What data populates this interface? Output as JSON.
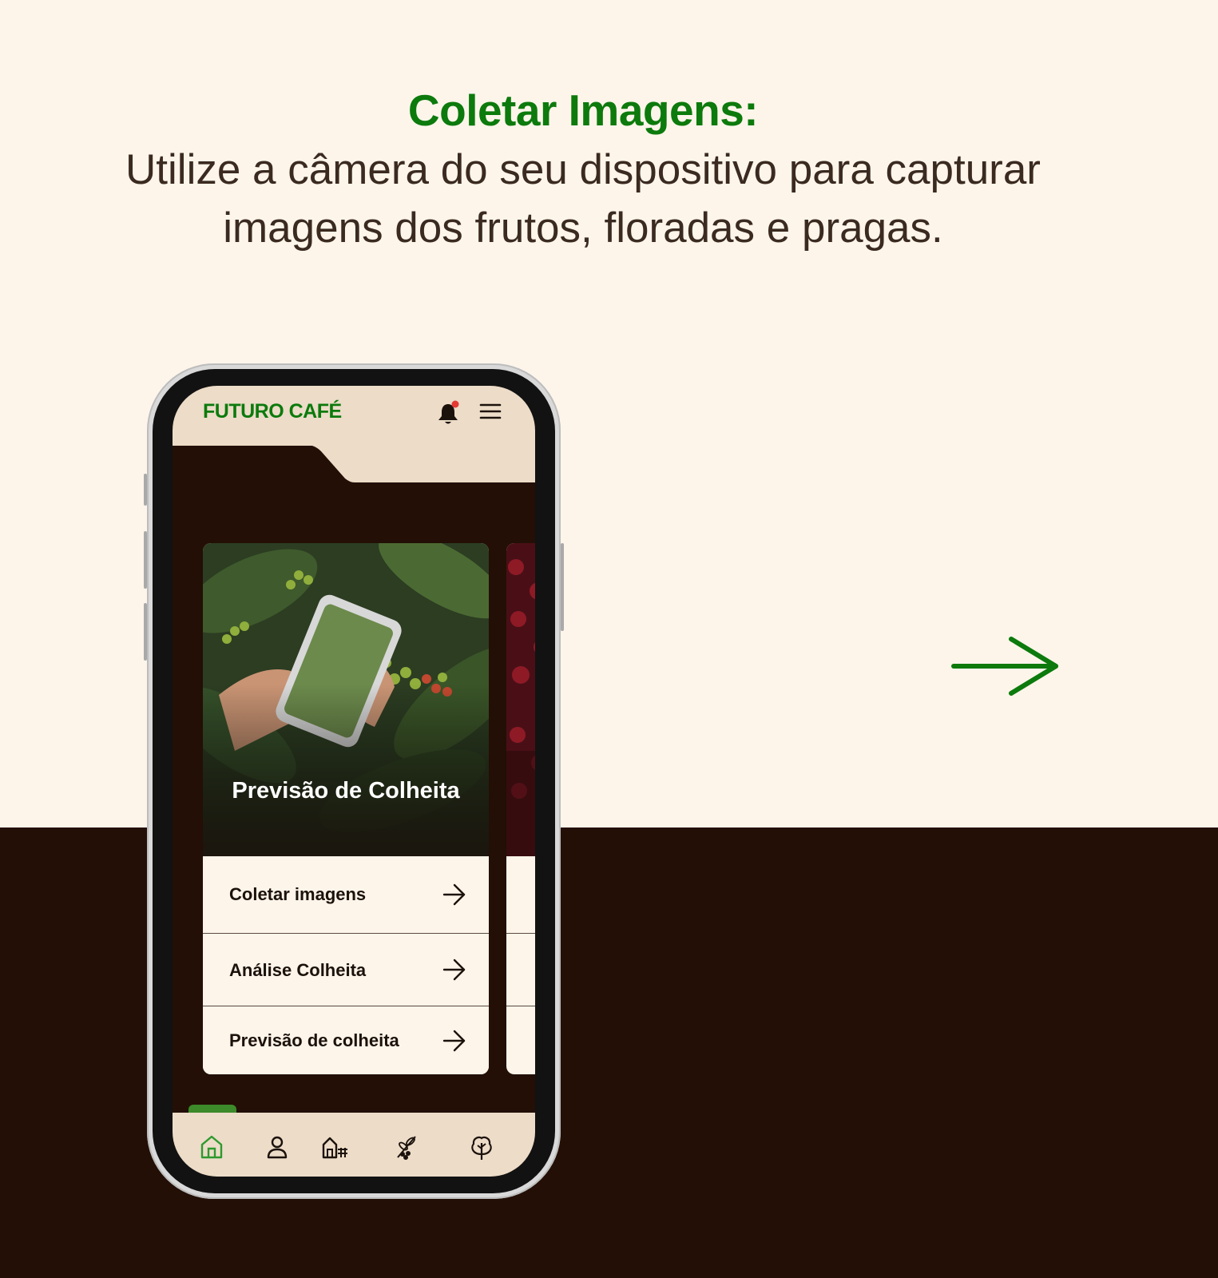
{
  "headline": {
    "title": "Coletar Imagens:",
    "body": "Utilize a câmera do seu dispositivo para capturar imagens dos frutos, floradas e pragas."
  },
  "colors": {
    "brand_green": "#0c7a0c",
    "dark_brown": "#230f05",
    "cream": "#fdf5ea",
    "header_beige": "#ecdcc8"
  },
  "app": {
    "brand": "FUTURO CAFÉ",
    "header_icons": [
      "bell-icon",
      "menu-icon"
    ],
    "card": {
      "title": "Previsão de Colheita",
      "items": [
        {
          "label": "Coletar imagens"
        },
        {
          "label": "Análise Colheita"
        },
        {
          "label": "Previsão de colheita"
        }
      ]
    },
    "bottom_nav": [
      "home-icon",
      "user-icon",
      "farm-icon",
      "coffee-branch-icon",
      "tree-icon"
    ],
    "active_nav": "home-icon"
  }
}
